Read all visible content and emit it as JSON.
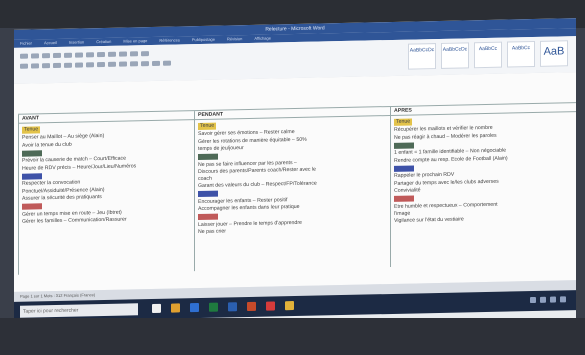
{
  "window": {
    "title": "Relecture - Microsoft Word"
  },
  "ribbon": {
    "tabs": [
      "Fichier",
      "Accueil",
      "Insertion",
      "Création",
      "Mise en page",
      "Références",
      "Publipostage",
      "Révision",
      "Affichage"
    ],
    "styles": [
      "AaBbCcDc",
      "AaBbCcDc",
      "AaBbCc",
      "AaBbCc",
      "AaB"
    ]
  },
  "table": {
    "columns": [
      {
        "header": "AVANT",
        "items": [
          {
            "chip": "#e3c34a",
            "text": "Tenue"
          },
          {
            "text": "Penser au Maillot – Au siège (Alain)"
          },
          {
            "text": "Avoir la tenue du club"
          },
          {
            "chip": "#4e6a57",
            "text": ""
          },
          {
            "text": "Prévoir la causerie de match – Court/Efficace"
          },
          {
            "text": "Heure de RDV précis – Heure/Jour/Lieu/Numéros"
          },
          {
            "chip": "#3e52a8",
            "text": ""
          },
          {
            "text": "Respecter la convocation"
          },
          {
            "text": "Ponctuel/Assiduité/Présence (Alain)"
          },
          {
            "text": "Assurer la sécurité des pratiquants"
          },
          {
            "chip": "#c05a5a",
            "text": ""
          },
          {
            "text": "Gérer un temps mise en route – Jeu (Ibtret)"
          },
          {
            "text": "Gérer les familles – Communication/Rassurer"
          }
        ]
      },
      {
        "header": "PENDANT",
        "items": [
          {
            "chip": "#e3c34a",
            "text": "Tenue"
          },
          {
            "text": "Savoir gérer ses émotions – Rester calme"
          },
          {
            "text": "Gérer les rotations de manière équitable – 50%"
          },
          {
            "text": "temps de jeu/joueur"
          },
          {
            "chip": "#4e6a57",
            "text": ""
          },
          {
            "text": "Ne pas se faire influencer par les parents –"
          },
          {
            "text": "Discours des parents/Parents coach/Rester avec le"
          },
          {
            "text": "coach"
          },
          {
            "text": "Garant des valeurs du club – Respect/FP/Tolérance"
          },
          {
            "chip": "#3e52a8",
            "text": ""
          },
          {
            "text": "Encourager les enfants – Rester positif"
          },
          {
            "text": "Accompagner les enfants dans leur pratique"
          },
          {
            "chip": "#c05a5a",
            "text": ""
          },
          {
            "text": "Laisser jouer – Prendre le temps d'apprendre"
          },
          {
            "text": "Ne pas crier"
          }
        ]
      },
      {
        "header": "APRES",
        "items": [
          {
            "chip": "#e3c34a",
            "text": "Tenue"
          },
          {
            "text": "Récupérer les maillots et vérifier le nombre"
          },
          {
            "text": "Ne pas réagir à chaud – Modérer les paroles"
          },
          {
            "chip": "#4e6a57",
            "text": ""
          },
          {
            "text": "1 enfant = 1 famille identifiable – Non négociable"
          },
          {
            "text": "Rendre compte au resp. Ecole de Football (Alain)"
          },
          {
            "chip": "#3e52a8",
            "text": ""
          },
          {
            "text": "Rappeler le prochain RDV"
          },
          {
            "text": "Partager du temps avec le/les clubs adverses"
          },
          {
            "text": "Convivialité"
          },
          {
            "chip": "#c05a5a",
            "text": ""
          },
          {
            "text": "Etre humble et respectueux – Comportement"
          },
          {
            "text": "l'image"
          },
          {
            "text": "Vigilance sur l'état du vestiaire"
          }
        ]
      }
    ]
  },
  "statusbar": {
    "text": "Page 1 sur 1   Mots : 312   Français (France)"
  },
  "taskbar": {
    "search_placeholder": "Taper ici pour rechercher"
  },
  "colors": {
    "accent": "#2f5597",
    "taskbar": "#1c2a44"
  }
}
